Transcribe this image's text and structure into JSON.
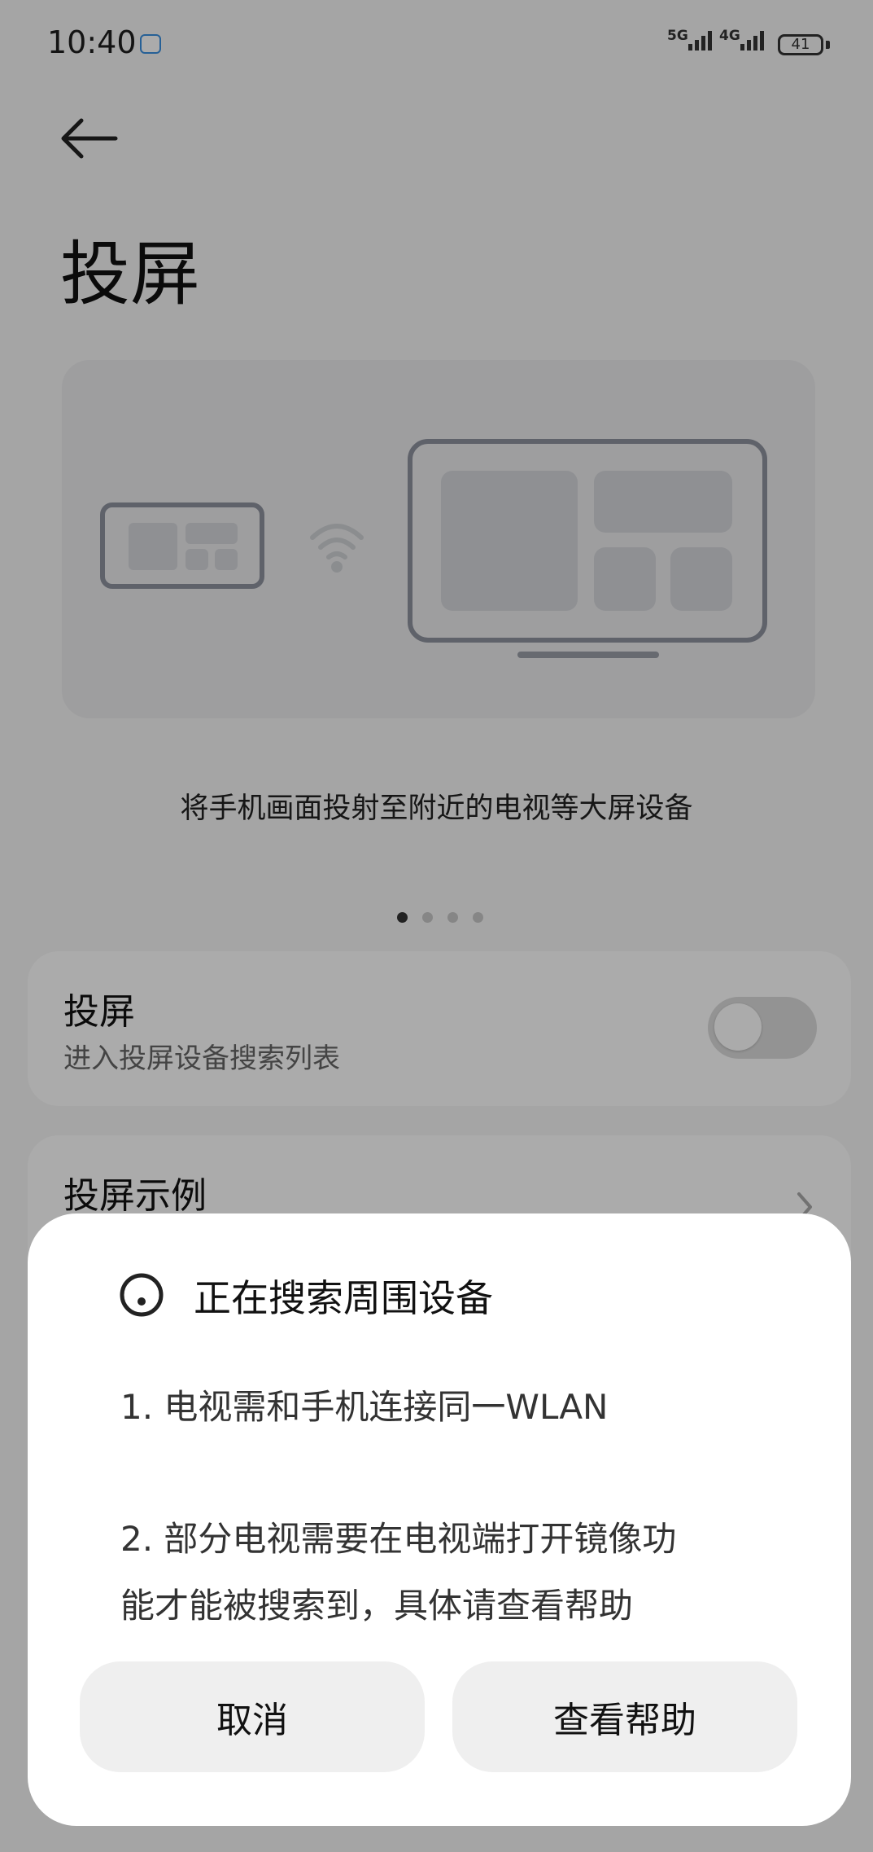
{
  "status_bar": {
    "time": "10:40",
    "net1": "5G",
    "net2": "4G",
    "battery": "41"
  },
  "page": {
    "title": "投屏",
    "caption": "将手机画面投射至附近的电视等大屏设备",
    "pager": {
      "count": 4,
      "active": 0
    }
  },
  "settings": {
    "cast_title": "投屏",
    "cast_subtitle": "进入投屏设备搜索列表",
    "cast_toggle_on": false,
    "example_title": "投屏示例"
  },
  "dialog": {
    "title": "正在搜索周围设备",
    "line1": "1. 电视需和手机连接同一WLAN",
    "line2a": "2. 部分电视需要在电视端打开镜像功",
    "line2b": "能才能被搜索到，具体请查看帮助",
    "cancel_label": "取消",
    "help_label": "查看帮助"
  },
  "icons": [
    "back-arrow-icon",
    "wifi-icon",
    "chevron-right-icon",
    "spinner-icon",
    "phone-illustration",
    "tv-illustration"
  ]
}
